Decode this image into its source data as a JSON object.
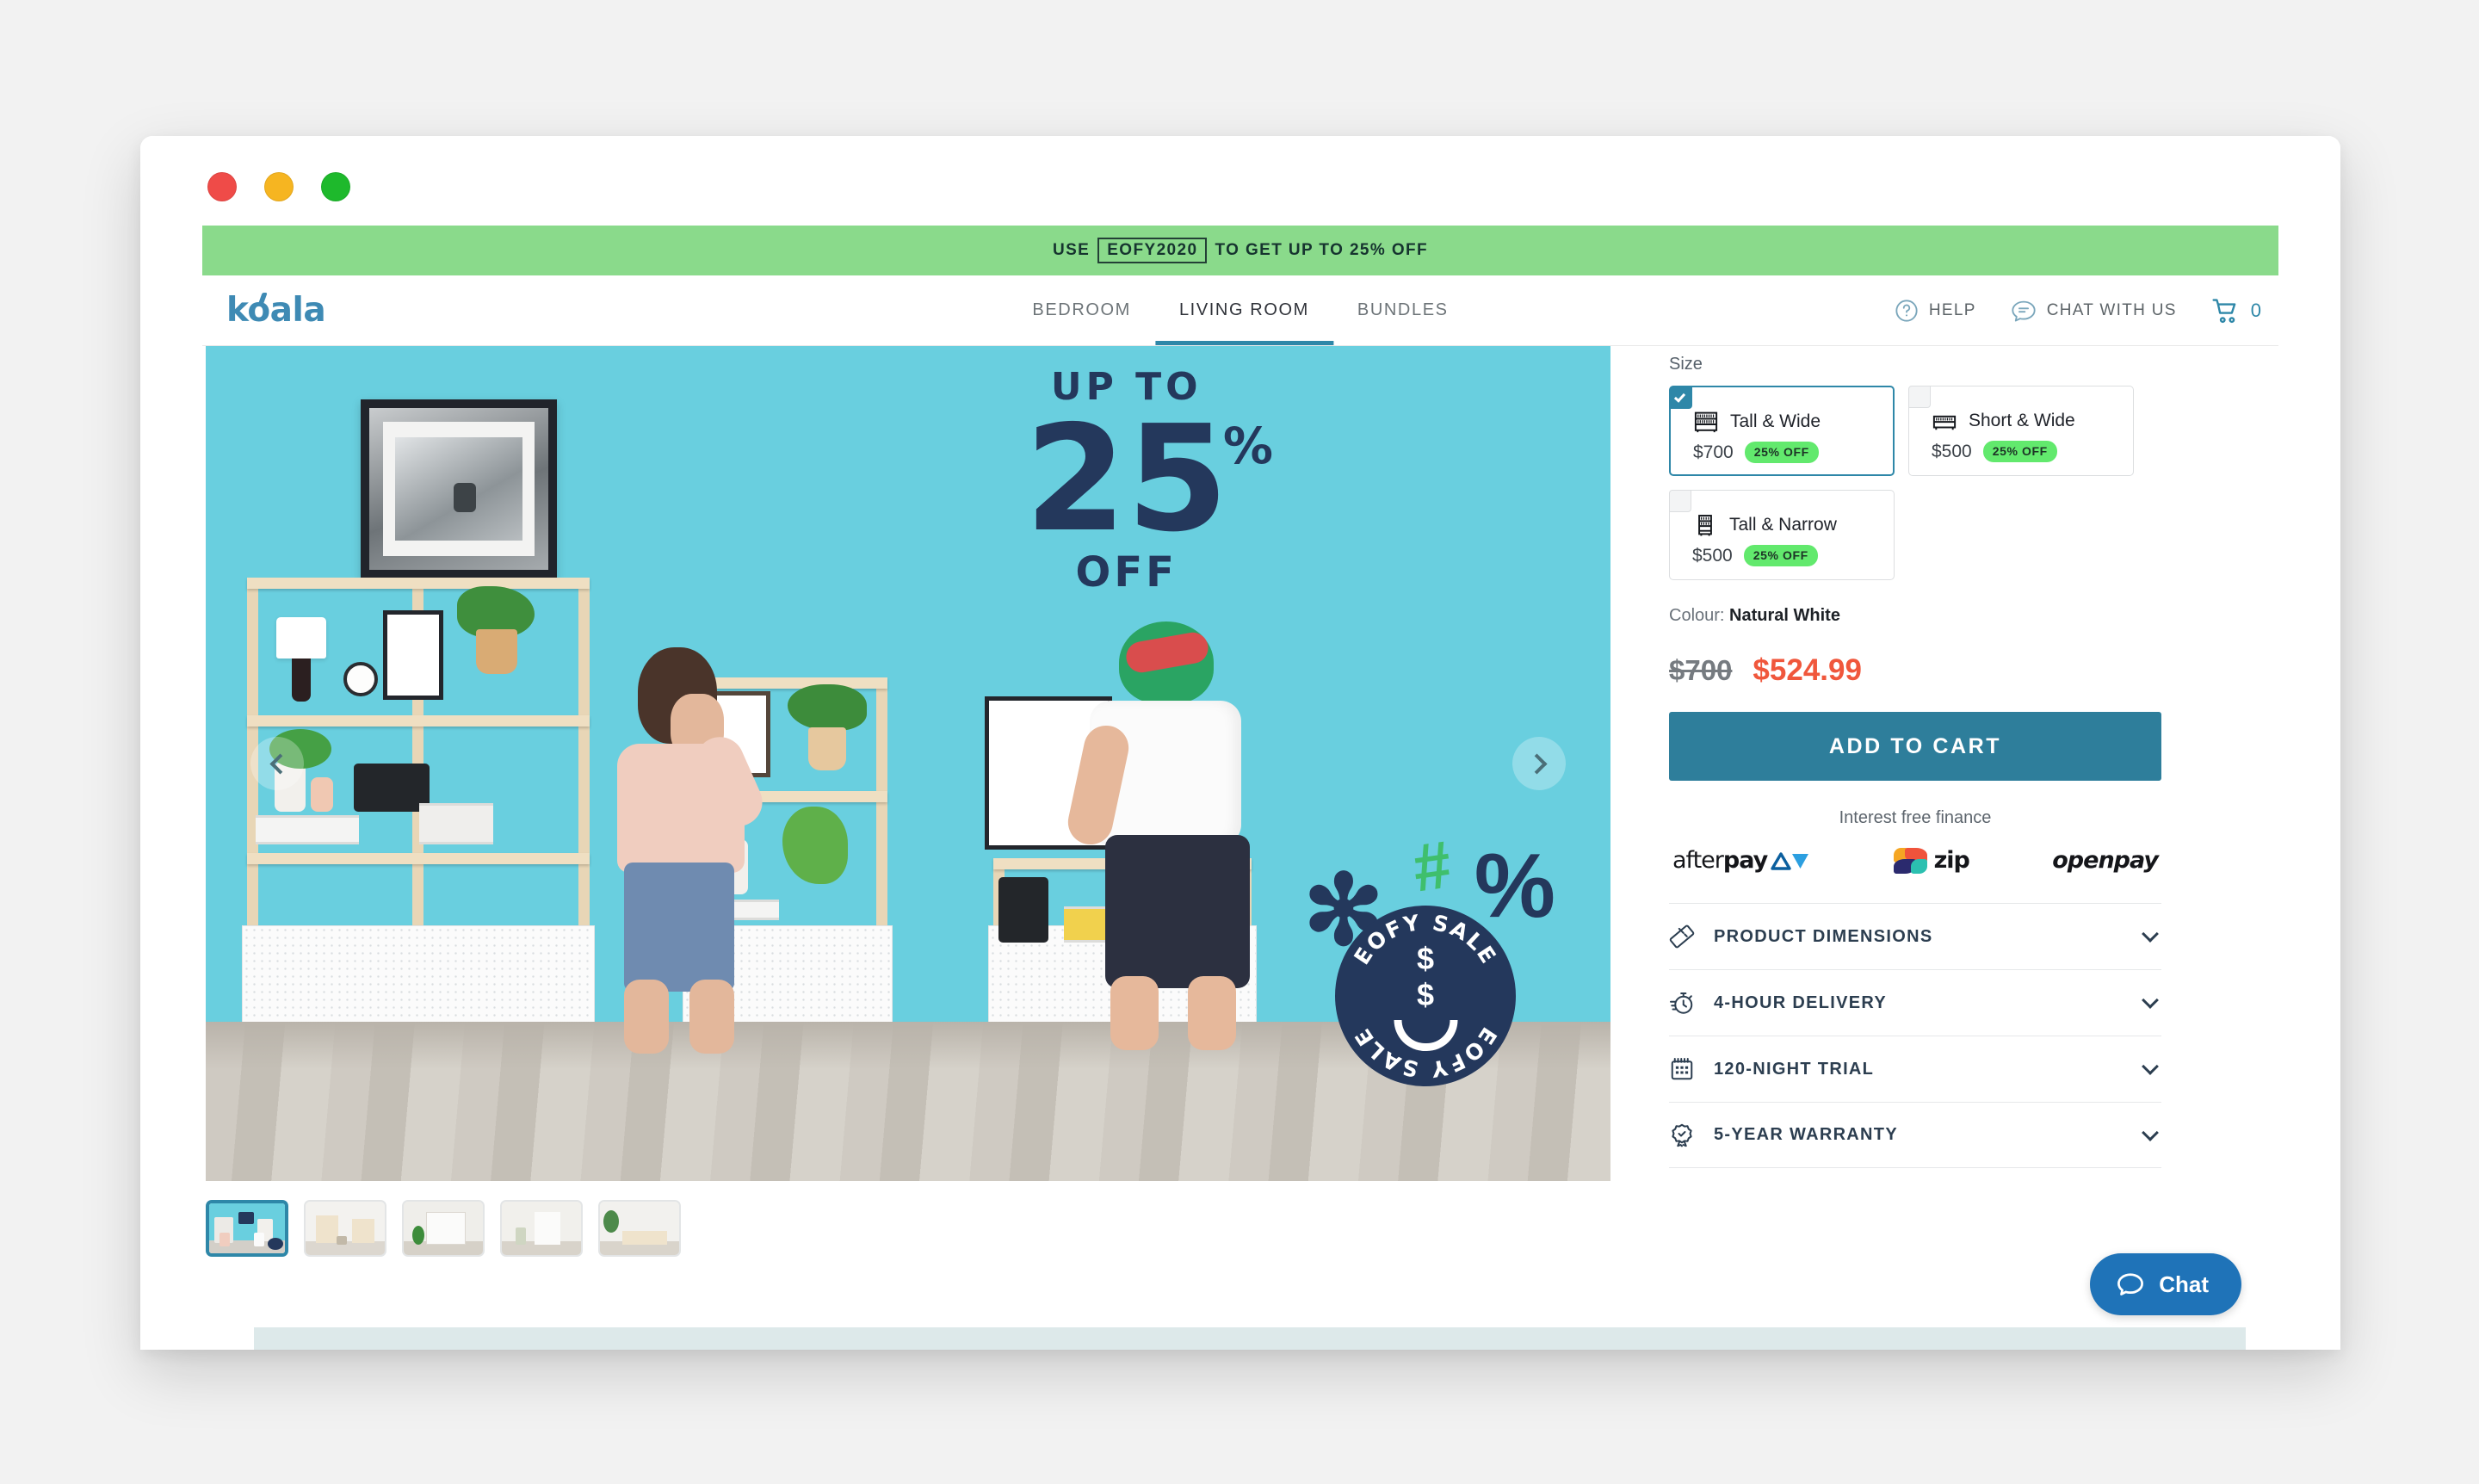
{
  "window": {
    "traffic_lights": [
      {
        "name": "close",
        "color": "#ef4b48"
      },
      {
        "name": "minimize",
        "color": "#f6b521"
      },
      {
        "name": "maximize",
        "color": "#1eb92c"
      }
    ]
  },
  "promo": {
    "prefix": "USE",
    "code": "EOFY2020",
    "suffix": "TO GET UP TO 25% OFF",
    "background": "#8ada8b"
  },
  "header": {
    "logo": "koala",
    "logo_color": "#3e8ab4",
    "nav": [
      {
        "label": "BEDROOM",
        "active": false
      },
      {
        "label": "LIVING ROOM",
        "active": true
      },
      {
        "label": "BUNDLES",
        "active": false
      }
    ],
    "help_label": "HELP",
    "chat_label": "CHAT WITH US",
    "cart_count": "0",
    "accent": "#2e87a8"
  },
  "hero": {
    "headline_top": "UP TO",
    "headline_number": "25",
    "headline_percent": "%",
    "headline_bottom": "OFF",
    "badge_line_top": "EOFY SALE",
    "badge_line_bottom": "EOFY SALE",
    "badge_eyes": "$ $",
    "wall_color": "#69cfdf",
    "ink_color": "#24385c",
    "prev_label": "Previous image",
    "next_label": "Next image"
  },
  "thumbnails": [
    {
      "label": "Image 1",
      "selected": true
    },
    {
      "label": "Image 2",
      "selected": false
    },
    {
      "label": "Image 3",
      "selected": false
    },
    {
      "label": "Image 4",
      "selected": false
    },
    {
      "label": "Image 5",
      "selected": false
    }
  ],
  "product": {
    "size_label": "Size",
    "sizes": [
      {
        "name": "Tall & Wide",
        "price": "$700",
        "discount": "25% OFF",
        "selected": true,
        "icon": "shelf-tall-wide-icon"
      },
      {
        "name": "Short & Wide",
        "price": "$500",
        "discount": "25% OFF",
        "selected": false,
        "icon": "shelf-short-wide-icon"
      },
      {
        "name": "Tall & Narrow",
        "price": "$500",
        "discount": "25% OFF",
        "selected": false,
        "icon": "shelf-tall-narrow-icon"
      }
    ],
    "colour_prefix": "Colour:",
    "colour_value": "Natural White",
    "price_old": "$700",
    "price_new": "$524.99",
    "cta_label": "ADD TO CART",
    "price_new_color": "#f0573c",
    "cta_color": "#2e7e9b",
    "discount_pill_color": "#62e96d"
  },
  "finance": {
    "title": "Interest free finance",
    "providers": [
      {
        "name": "afterpay",
        "text_light": "after",
        "text_bold": "pay"
      },
      {
        "name": "zip",
        "text_bold": "zip"
      },
      {
        "name": "openpay",
        "text_bold": "openpay"
      }
    ]
  },
  "accordion": [
    {
      "label": "PRODUCT DIMENSIONS",
      "icon": "ruler-icon"
    },
    {
      "label": "4-HOUR DELIVERY",
      "icon": "stopwatch-icon"
    },
    {
      "label": "120-NIGHT TRIAL",
      "icon": "calendar-icon"
    },
    {
      "label": "5-YEAR WARRANTY",
      "icon": "badge-check-icon"
    }
  ],
  "chat_widget": {
    "label": "Chat",
    "color": "#1f73b8"
  }
}
